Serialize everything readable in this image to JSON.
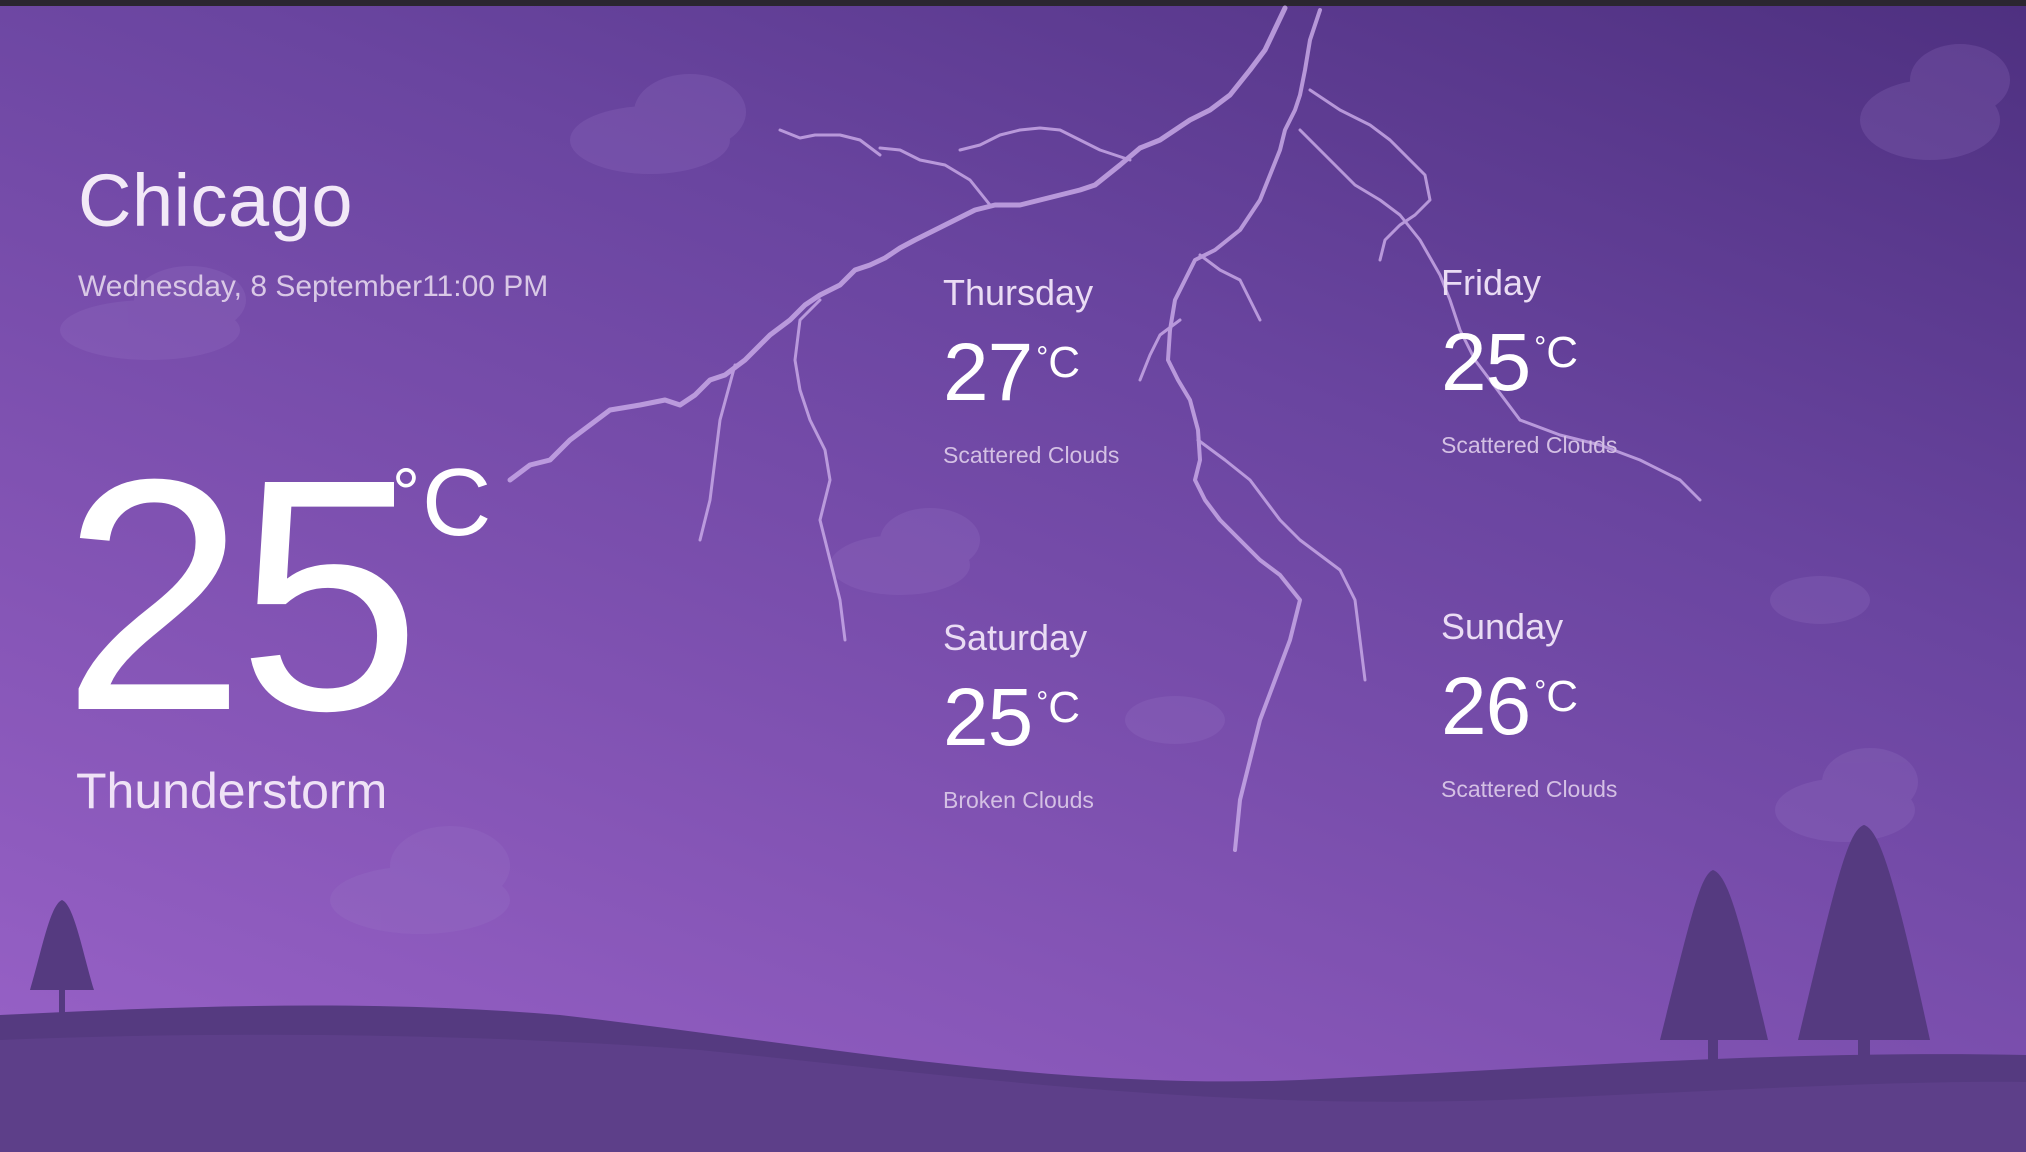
{
  "app": {
    "city": "Chicago",
    "datetime": "Wednesday, 8 September11:00 PM"
  },
  "current": {
    "temperature": "25",
    "unit": "C",
    "degree_symbol": "°",
    "condition": "Thunderstorm"
  },
  "forecast": [
    {
      "day": "Thursday",
      "temperature": "27",
      "unit": "C",
      "degree_symbol": "°",
      "condition": "Scattered Clouds"
    },
    {
      "day": "Friday",
      "temperature": "25",
      "unit": "C",
      "degree_symbol": "°",
      "condition": "Scattered Clouds"
    },
    {
      "day": "Saturday",
      "temperature": "25",
      "unit": "C",
      "degree_symbol": "°",
      "condition": "Broken Clouds"
    },
    {
      "day": "Sunday",
      "temperature": "26",
      "unit": "C",
      "degree_symbol": "°",
      "condition": "Scattered Clouds"
    }
  ],
  "theme": {
    "background_top": "#4e3080",
    "background_bottom": "#9a63c9",
    "ground": "#553a80",
    "lightning": "#c7a8e6"
  },
  "icons": [
    "lightning-bolt",
    "cloud",
    "tree",
    "hill"
  ]
}
